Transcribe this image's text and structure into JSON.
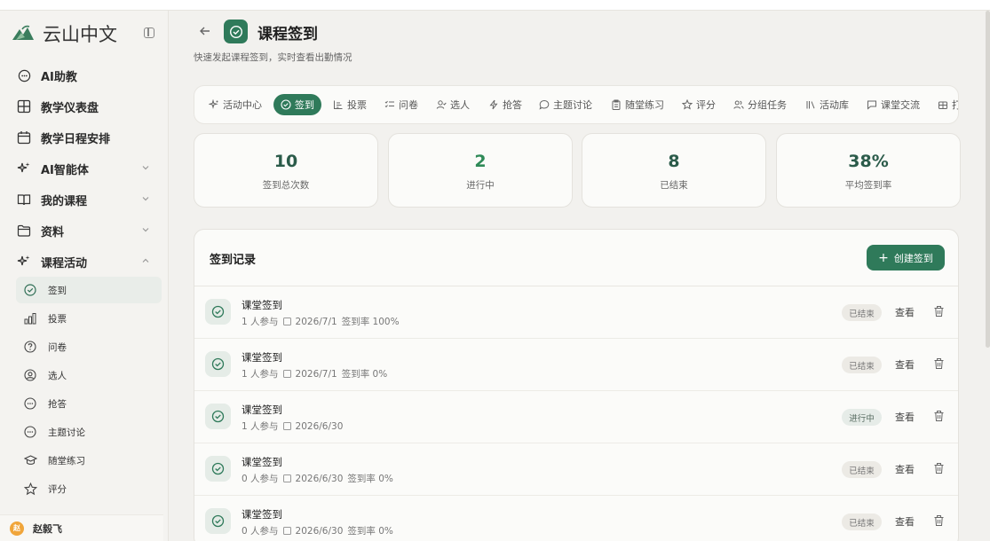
{
  "app": {
    "brand_name": "云山中文"
  },
  "sidebar": {
    "items": [
      {
        "label": "AI助教",
        "icon": "chat-bubble-icon"
      },
      {
        "label": "教学仪表盘",
        "icon": "dashboard-grid-icon"
      },
      {
        "label": "教学日程安排",
        "icon": "calendar-icon"
      },
      {
        "label": "AI智能体",
        "icon": "sparkle-icon",
        "expandable": true
      },
      {
        "label": "我的课程",
        "icon": "book-icon",
        "expandable": true
      },
      {
        "label": "资料",
        "icon": "folder-icon",
        "expandable": true
      },
      {
        "label": "课程活动",
        "icon": "sparkle-icon",
        "expandable": true,
        "expanded": true
      }
    ],
    "sub_items": [
      {
        "label": "签到",
        "icon": "check-circle-icon",
        "active": true
      },
      {
        "label": "投票",
        "icon": "bar-chart-icon"
      },
      {
        "label": "问卷",
        "icon": "question-circle-icon"
      },
      {
        "label": "选人",
        "icon": "user-circle-icon"
      },
      {
        "label": "抢答",
        "icon": "chat-dots-icon"
      },
      {
        "label": "主题讨论",
        "icon": "chat-dots-icon"
      },
      {
        "label": "随堂练习",
        "icon": "graduation-cap-icon"
      },
      {
        "label": "评分",
        "icon": "star-icon"
      }
    ],
    "user": {
      "avatar_text": "赵",
      "name": "赵毅飞"
    }
  },
  "header": {
    "title": "课程签到",
    "subtitle": "快速发起课程签到，实时查看出勤情况"
  },
  "tabs": [
    {
      "label": "活动中心",
      "icon": "sparkle-icon"
    },
    {
      "label": "签到",
      "icon": "check-circle-icon",
      "active": true
    },
    {
      "label": "投票",
      "icon": "bar-chart-icon"
    },
    {
      "label": "问卷",
      "icon": "list-check-icon"
    },
    {
      "label": "选人",
      "icon": "user-pick-icon"
    },
    {
      "label": "抢答",
      "icon": "lightning-icon"
    },
    {
      "label": "主题讨论",
      "icon": "speech-bubble-icon"
    },
    {
      "label": "随堂练习",
      "icon": "clipboard-icon"
    },
    {
      "label": "评分",
      "icon": "star-icon"
    },
    {
      "label": "分组任务",
      "icon": "users-icon"
    },
    {
      "label": "活动库",
      "icon": "library-icon"
    },
    {
      "label": "课堂交流",
      "icon": "message-icon"
    },
    {
      "label": "打",
      "icon": "grid-icon"
    }
  ],
  "stats": [
    {
      "value": "10",
      "label": "签到总次数"
    },
    {
      "value": "2",
      "label": "进行中"
    },
    {
      "value": "8",
      "label": "已结束"
    },
    {
      "value": "38%",
      "label": "平均签到率"
    }
  ],
  "records": {
    "title": "签到记录",
    "create_label": "创建签到",
    "view_label": "查看",
    "rows": [
      {
        "title": "课堂签到",
        "participants": "1 人参与",
        "date": "2026/7/1",
        "rate": "签到率 100%",
        "status": "已结束"
      },
      {
        "title": "课堂签到",
        "participants": "1 人参与",
        "date": "2026/7/1",
        "rate": "签到率 0%",
        "status": "已结束"
      },
      {
        "title": "课堂签到",
        "participants": "1 人参与",
        "date": "2026/6/30",
        "rate": "",
        "status": "进行中"
      },
      {
        "title": "课堂签到",
        "participants": "0 人参与",
        "date": "2026/6/30",
        "rate": "签到率 0%",
        "status": "已结束"
      },
      {
        "title": "课堂签到",
        "participants": "0 人参与",
        "date": "2026/6/30",
        "rate": "签到率 0%",
        "status": "已结束"
      }
    ]
  },
  "colors": {
    "accent": "#2f7a5a",
    "background": "#f2f1ee",
    "card": "#fbfbf9"
  }
}
